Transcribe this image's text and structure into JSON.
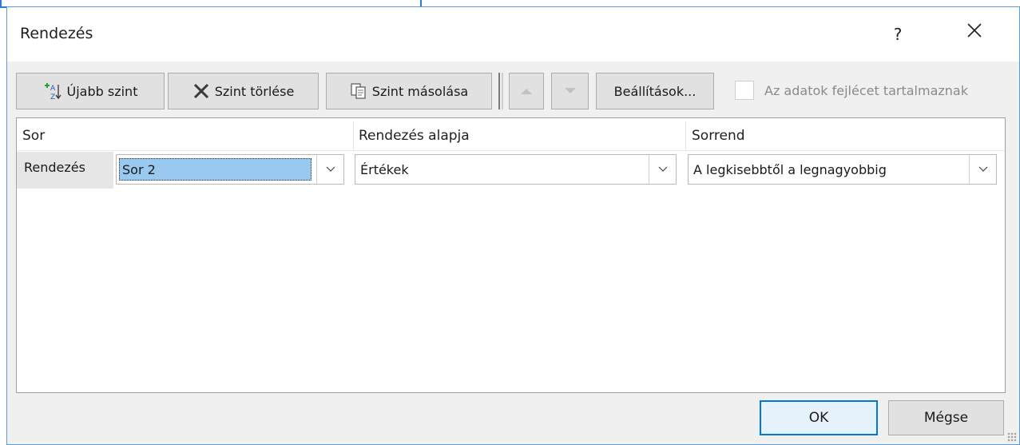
{
  "dialog": {
    "title": "Rendezés",
    "help_label": "?",
    "close_icon": "close-icon"
  },
  "toolbar": {
    "add_level_label": "Újabb szint",
    "add_level_icon": "sort-add-icon",
    "delete_level_label": "Szint törlése",
    "delete_level_icon": "delete-x-icon",
    "copy_level_label": "Szint másolása",
    "copy_level_icon": "copy-icon",
    "move_up_icon": "arrow-up-icon",
    "move_down_icon": "arrow-down-icon",
    "options_label": "Beállítások...",
    "header_checkbox_label": "Az adatok fejlécet tartalmaznak",
    "header_checkbox_checked": false
  },
  "grid": {
    "columns": [
      "Sor",
      "Rendezés alapja",
      "Sorrend"
    ],
    "rows": [
      {
        "label": "Rendezés",
        "row": "Sor 2",
        "sort_on": "Értékek",
        "order": "A legkisebbtől a legnagyobbig"
      }
    ]
  },
  "buttons": {
    "ok": "OK",
    "cancel": "Mégse"
  },
  "colors": {
    "accent": "#0078d7",
    "selection": "#99c9ef",
    "dialog_bg": "#f0f0f0"
  }
}
